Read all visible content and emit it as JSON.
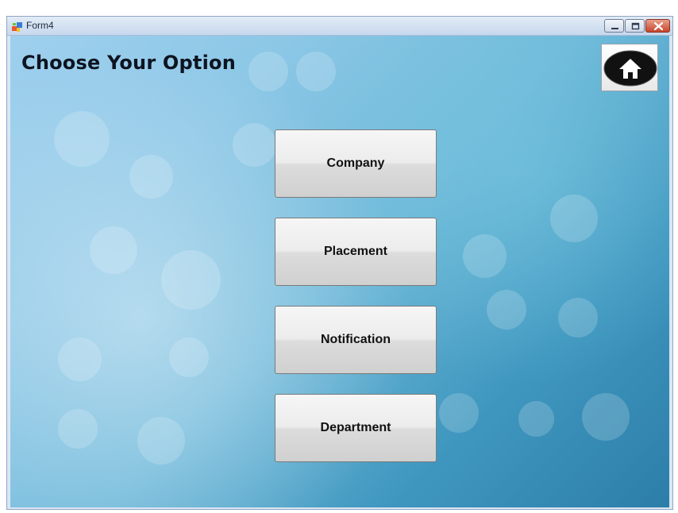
{
  "window": {
    "title": "Form4",
    "icons": {
      "app": "form-app-icon",
      "minimize": "minimize-icon",
      "maximize": "maximize-icon",
      "close": "close-icon"
    }
  },
  "main": {
    "heading": "Choose Your Option",
    "home_icon": "home-icon",
    "options": [
      {
        "label": "Company"
      },
      {
        "label": "Placement"
      },
      {
        "label": "Notification"
      },
      {
        "label": "Department"
      }
    ]
  },
  "colors": {
    "background_start": "#9fd0ee",
    "background_end": "#2c7ea8",
    "button_face": "#e6e6e6",
    "heading_text": "#0d1420"
  }
}
